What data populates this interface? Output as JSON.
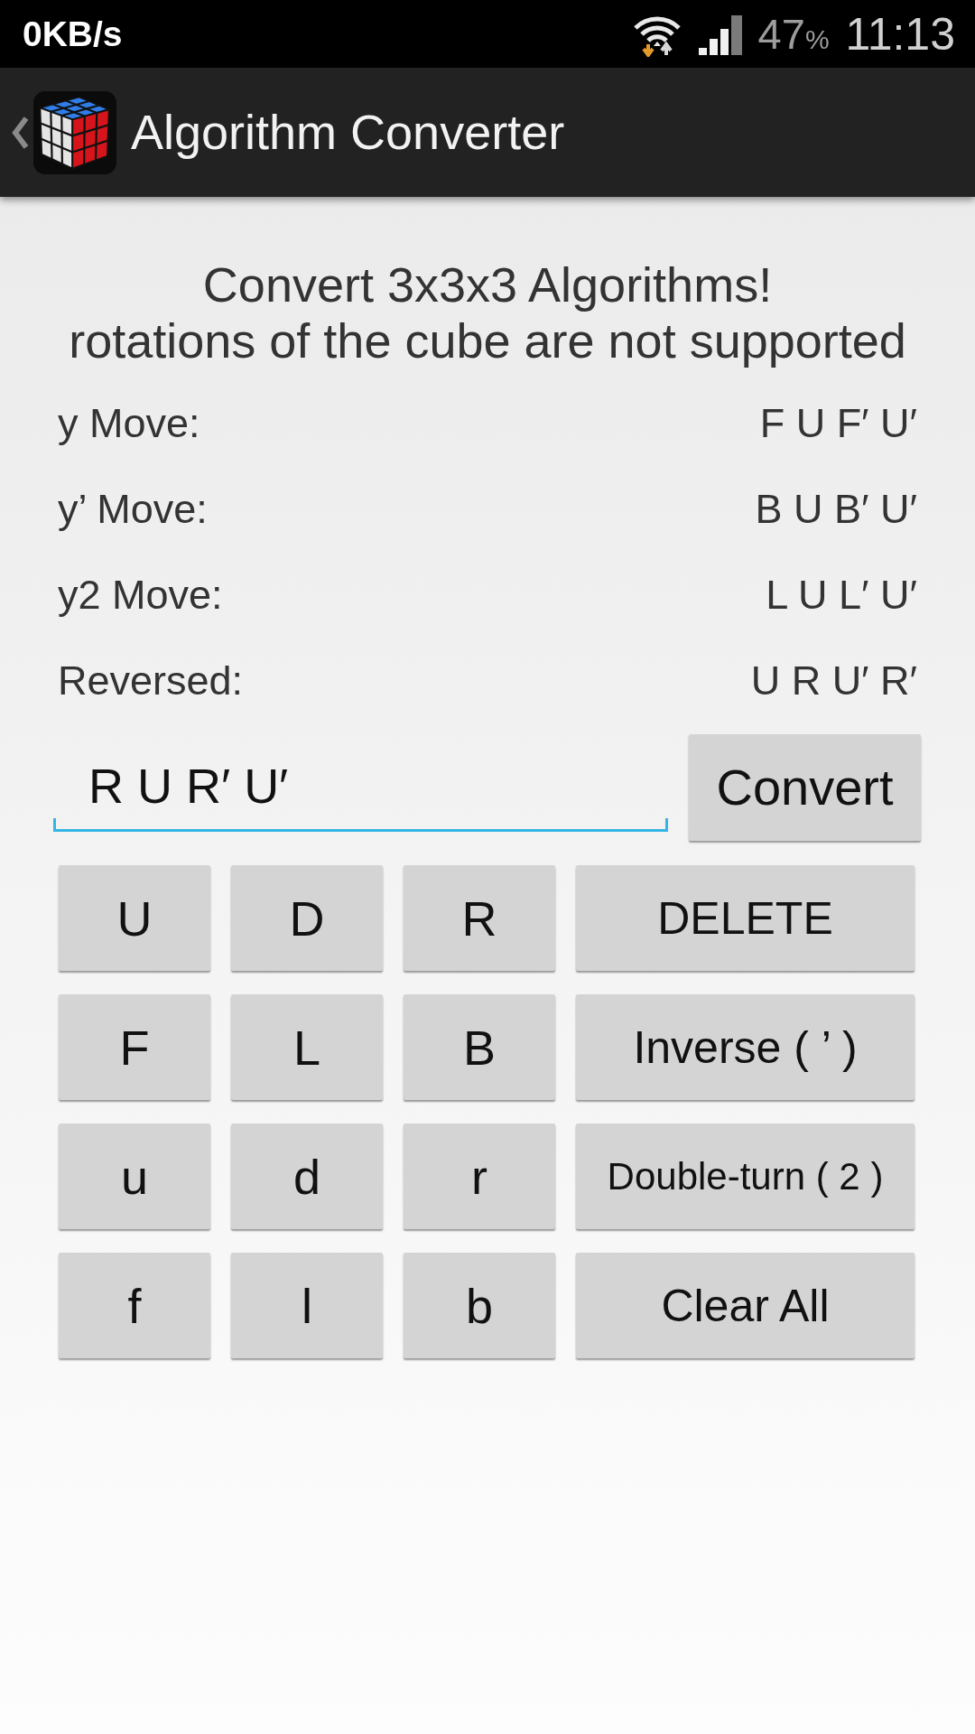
{
  "status_bar": {
    "speed": "0KB/s",
    "battery": "47",
    "battery_unit": "%",
    "time": "11:13"
  },
  "action_bar": {
    "title": "Algorithm Converter"
  },
  "intro": {
    "lines": [
      "Convert 3x3x3 Algorithms!",
      "rotations of the cube are not supported"
    ]
  },
  "results": [
    {
      "label": "y Move:",
      "value": "F U F′ U′"
    },
    {
      "label": "y’ Move:",
      "value": "B U B′ U′"
    },
    {
      "label": "y2 Move:",
      "value": "L U L′ U′"
    },
    {
      "label": "Reversed:",
      "value": "U R U′ R′"
    }
  ],
  "input": {
    "value": "R U R′ U′",
    "focused": true
  },
  "convert_button": {
    "label": "Convert"
  },
  "keypad": [
    {
      "keys": [
        {
          "label": "U",
          "kind": "move"
        },
        {
          "label": "D",
          "kind": "move"
        },
        {
          "label": "R",
          "kind": "move"
        },
        {
          "label": "DELETE",
          "kind": "command"
        }
      ]
    },
    {
      "keys": [
        {
          "label": "F",
          "kind": "move"
        },
        {
          "label": "L",
          "kind": "move"
        },
        {
          "label": "B",
          "kind": "move"
        },
        {
          "label": "Inverse ( ’ )",
          "kind": "command"
        }
      ]
    },
    {
      "keys": [
        {
          "label": "u",
          "kind": "move"
        },
        {
          "label": "d",
          "kind": "move"
        },
        {
          "label": "r",
          "kind": "move"
        },
        {
          "label": "Double-turn ( 2 )",
          "kind": "command"
        }
      ]
    },
    {
      "keys": [
        {
          "label": "f",
          "kind": "move"
        },
        {
          "label": "l",
          "kind": "move"
        },
        {
          "label": "b",
          "kind": "move"
        },
        {
          "label": "Clear All",
          "kind": "command"
        }
      ]
    }
  ]
}
